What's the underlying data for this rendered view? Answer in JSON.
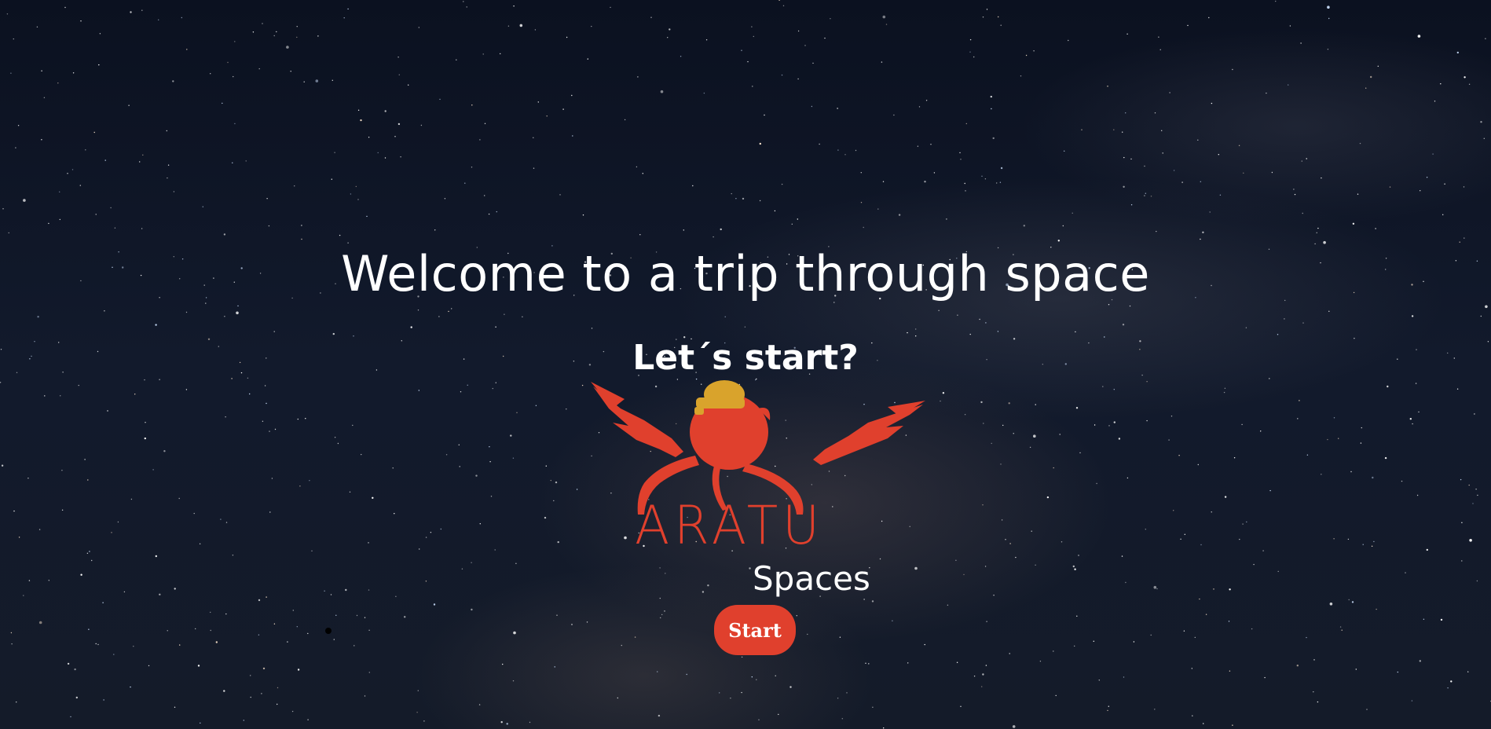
{
  "hero": {
    "title": "Welcome to a trip through space",
    "subtitle": "Let´s start?"
  },
  "logo": {
    "icon": "crab-with-hat-logo",
    "wordmark": "ARATU",
    "tagline": "Spaces"
  },
  "actions": {
    "start_label": "Start"
  },
  "colors": {
    "accent": "#e0402d",
    "hat": "#d9a32c",
    "text": "#ffffff",
    "background": "#0d1320"
  }
}
